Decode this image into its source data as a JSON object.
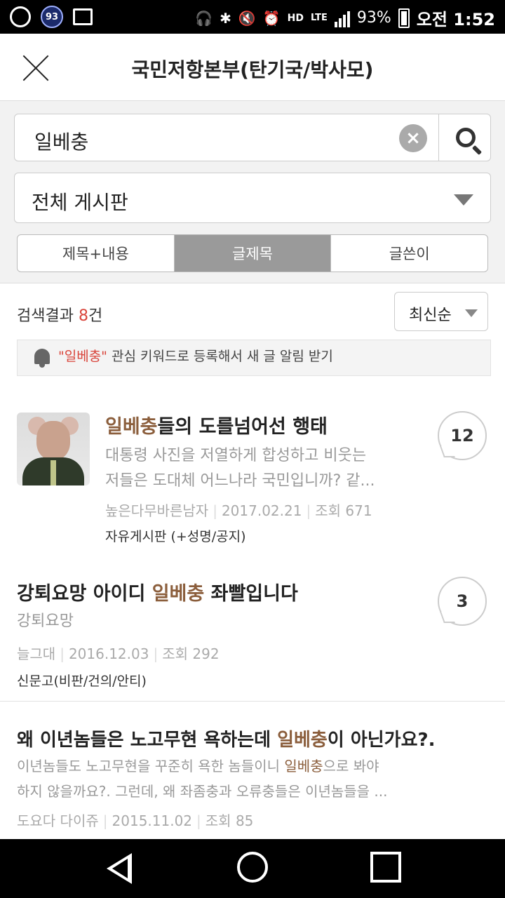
{
  "status_bar": {
    "badge": "93",
    "network": "LTE",
    "hd": "HD",
    "battery": "93%",
    "time": "오전 1:52"
  },
  "header": {
    "title": "국민저항본부(탄기국/박사모)"
  },
  "search": {
    "query": "일베충",
    "board": "전체 게시판",
    "tabs": [
      "제목+내용",
      "글제목",
      "글쓴이"
    ],
    "active_tab": "글제목"
  },
  "result": {
    "prefix": "검색결과",
    "count": "8",
    "suffix": "건",
    "sort": "최신순"
  },
  "alert": {
    "keyword": "\"일베충\"",
    "text": "관심 키워드로 등록해서 새 글 알림 받기"
  },
  "posts": [
    {
      "title_hl": "일베충",
      "title_rest": "들의 도를넘어선 행태",
      "preview_1": "대통령 사진을 저열하게 합성하고 비웃는",
      "preview_2": "저들은 도대체 어느나라 국민입니까? 같...",
      "author": "높은다무바른남자",
      "date": "2017.02.21",
      "views": "조회 671",
      "board": "자유게시판 (+성명/공지)",
      "comments": "12"
    },
    {
      "title_pre": "강퇴요망 아이디 ",
      "title_hl": "일베충",
      "title_post": " 좌빨입니다",
      "preview_1": "강퇴요망",
      "author": "늘그대",
      "date": "2016.12.03",
      "views": "조회 292",
      "board": "신문고(비판/건의/안티)",
      "comments": "3"
    },
    {
      "title_pre": "왜 이년놈들은 노고무현 욕하는데 ",
      "title_hl": "일베충",
      "title_post": "이 아닌가요?.",
      "preview_1_pre": "이년놈들도 노고무현을 꾸준히 욕한 놈들이니 ",
      "preview_1_hl": "일베충",
      "preview_1_post": "으로 봐야",
      "preview_2": "하지 않을까요?. 그런데, 왜 좌좀충과 오류충들은 이년놈들을 ...",
      "author": "도요다 다이쥬",
      "date": "2015.11.02",
      "views": "조회 85"
    }
  ]
}
